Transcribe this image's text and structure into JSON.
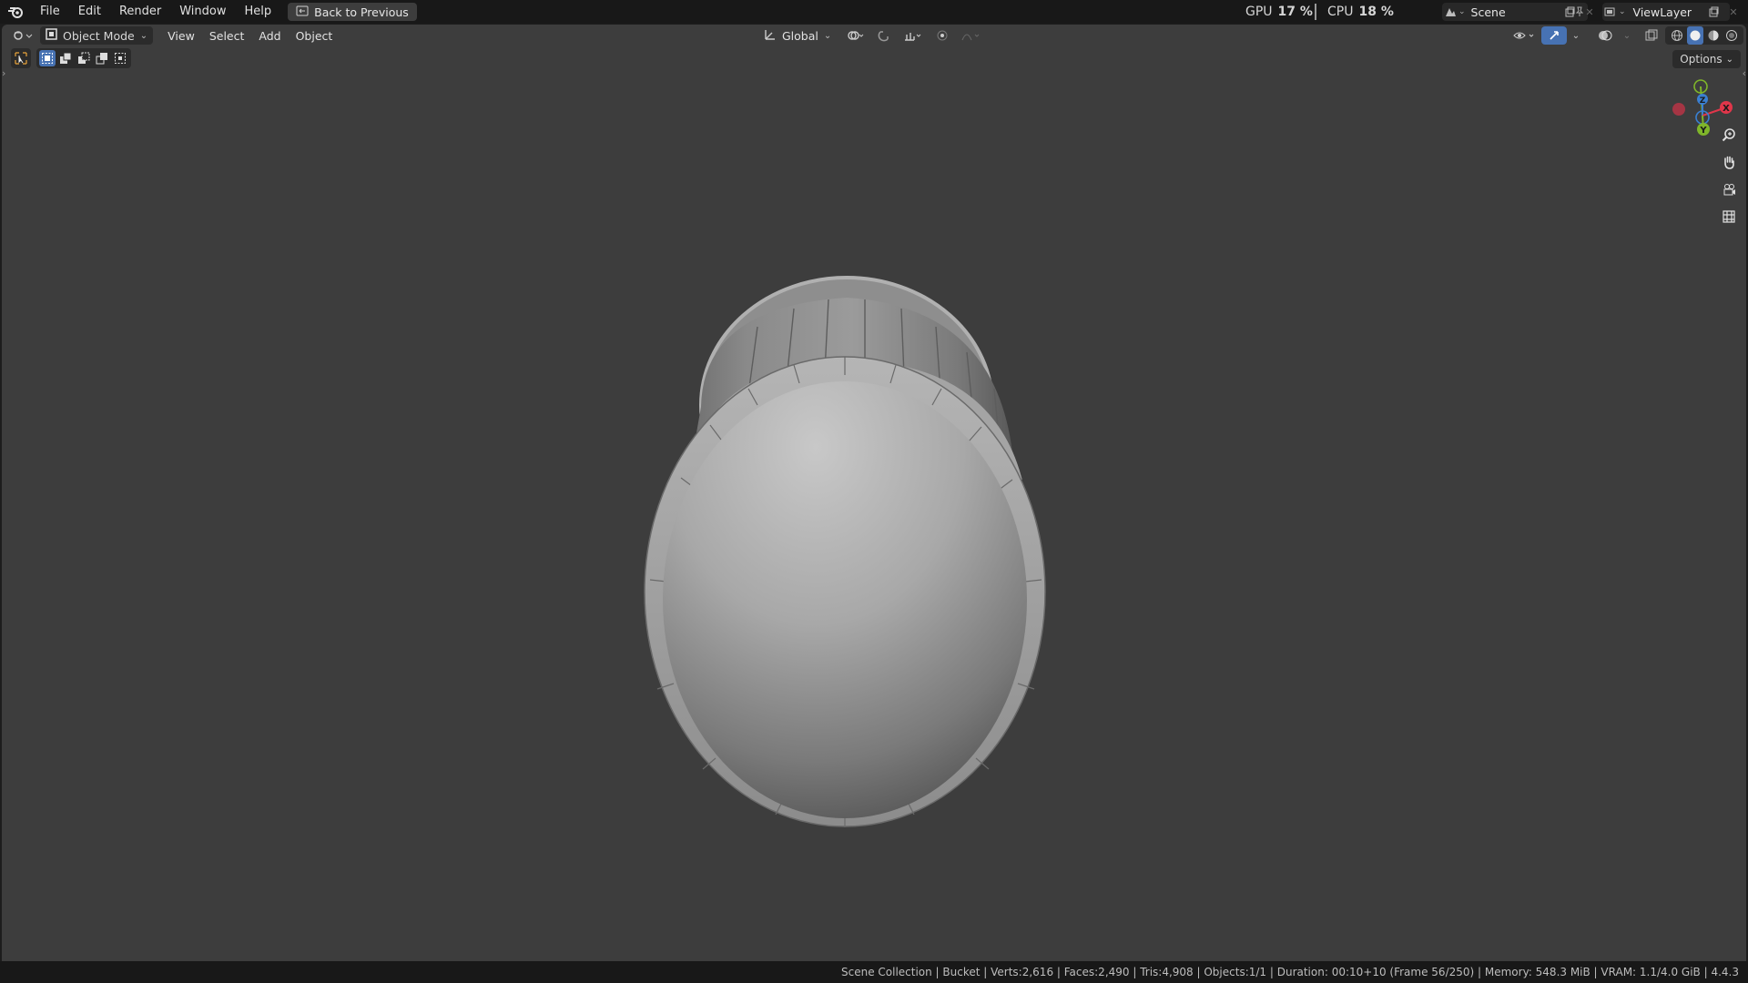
{
  "app": {
    "menu": [
      "File",
      "Edit",
      "Render",
      "Window",
      "Help"
    ],
    "back_button": "Back to Previous"
  },
  "perf": {
    "gpu_label": "GPU",
    "gpu_value": "17 %",
    "cpu_label": "CPU",
    "cpu_value": "18 %"
  },
  "scene": {
    "name": "Scene",
    "view_layer": "ViewLayer"
  },
  "viewport_header": {
    "mode": "Object Mode",
    "menus": [
      "View",
      "Select",
      "Add",
      "Object"
    ],
    "transform_orientation": "Global"
  },
  "options_label": "Options",
  "gizmo": {
    "x": "X",
    "y": "Y",
    "z": "Z"
  },
  "status": "Scene Collection | Bucket | Verts:2,616 | Faces:2,490 | Tris:4,908 | Objects:1/1 | Duration: 00:10+10 (Frame 56/250) | Memory: 548.3 MiB | VRAM: 1.1/4.0 GiB | 4.4.3",
  "colors": {
    "accent": "#4772b3",
    "viewport_bg": "#3d3d3d",
    "gizmo_x": "#e0364a",
    "gizmo_y": "#7fb52a",
    "gizmo_z": "#3a7fd1"
  },
  "icons": [
    "blender-logo-icon",
    "back-icon",
    "editor-type-icon",
    "object-mode-icon",
    "orientation-icon",
    "pivot-icon",
    "snap-icon",
    "proportional-icon",
    "visibility-icon",
    "gizmo-icon",
    "overlay-icon",
    "xray-icon",
    "shading-wire-icon",
    "shading-solid-icon",
    "shading-material-icon",
    "shading-rendered-icon",
    "zoom-icon",
    "pan-hand-icon",
    "camera-icon",
    "grid-icon",
    "pin-icon",
    "new-scene-icon",
    "close-icon"
  ]
}
